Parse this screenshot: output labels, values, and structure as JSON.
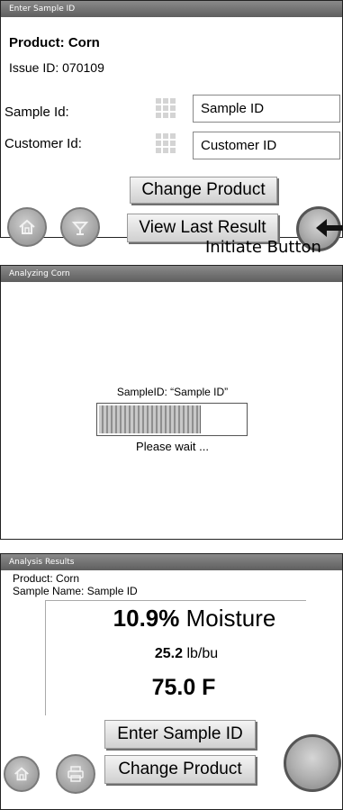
{
  "screen1": {
    "title": "Enter Sample ID",
    "product_label": "Product:",
    "product_value": "Corn",
    "issue_label": "Issue ID:",
    "issue_value": "070109",
    "sample_label": "Sample Id:",
    "sample_value": "Sample ID",
    "customer_label": "Customer Id:",
    "customer_value": "Customer ID",
    "change_product": "Change Product",
    "view_last_result": "View Last Result"
  },
  "annotation": "Initiate Button",
  "screen2": {
    "title": "Analyzing Corn",
    "sample_line": "SampleID: “Sample ID”",
    "progress_fraction": 0.7,
    "wait_text": "Please wait ..."
  },
  "screen3": {
    "title": "Analysis Results",
    "product_line": "Product: Corn",
    "sample_line": "Sample Name: Sample ID",
    "moisture_value": "10.9",
    "moisture_unit": "%",
    "moisture_label": "Moisture",
    "test_weight_value": "25.2",
    "test_weight_unit": "lb/bu",
    "temperature": "75.0 F",
    "enter_sample_id": "Enter Sample ID",
    "change_product": "Change Product"
  }
}
